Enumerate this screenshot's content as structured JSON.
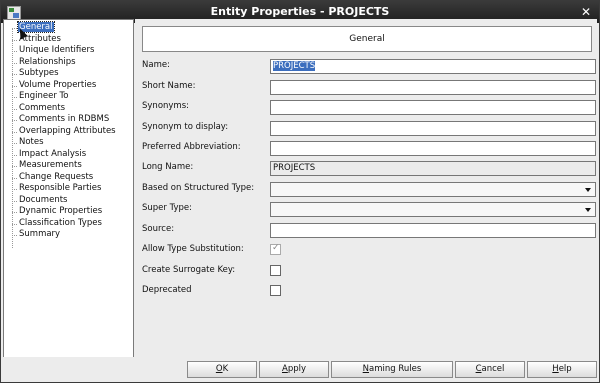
{
  "window": {
    "title": "Entity Properties - PROJECTS",
    "close_glyph": "✕"
  },
  "nav": {
    "items": [
      {
        "label": "General",
        "selected": true
      },
      {
        "label": "Attributes"
      },
      {
        "label": "Unique Identifiers"
      },
      {
        "label": "Relationships"
      },
      {
        "label": "Subtypes"
      },
      {
        "label": "Volume Properties"
      },
      {
        "label": "Engineer To"
      },
      {
        "label": "Comments"
      },
      {
        "label": "Comments in RDBMS"
      },
      {
        "label": "Overlapping Attributes"
      },
      {
        "label": "Notes"
      },
      {
        "label": "Impact Analysis"
      },
      {
        "label": "Measurements"
      },
      {
        "label": "Change Requests"
      },
      {
        "label": "Responsible Parties"
      },
      {
        "label": "Documents"
      },
      {
        "label": "Dynamic Properties"
      },
      {
        "label": "Classification Types"
      },
      {
        "label": "Summary"
      }
    ]
  },
  "panel": {
    "header": "General",
    "name": {
      "label": "Name:",
      "value": "PROJECTS"
    },
    "short_name": {
      "label": "Short Name:",
      "value": ""
    },
    "synonyms": {
      "label": "Synonyms:",
      "value": ""
    },
    "synonym_display": {
      "label": "Synonym to display:",
      "value": ""
    },
    "preferred_abbrev": {
      "label": "Preferred Abbreviation:",
      "value": ""
    },
    "long_name": {
      "label": "Long Name:",
      "value": "PROJECTS"
    },
    "based_on": {
      "label": "Based on Structured Type:",
      "value": ""
    },
    "super_type": {
      "label": "Super Type:",
      "value": ""
    },
    "source": {
      "label": "Source:",
      "value": ""
    },
    "allow_subst": {
      "label": "Allow Type Substitution:",
      "checked": true
    },
    "surrogate": {
      "label": "Create Surrogate Key:",
      "checked": false
    },
    "deprecated": {
      "label": "Deprecated",
      "checked": false
    }
  },
  "buttons": {
    "ok": {
      "mnemonic": "O",
      "rest": "K"
    },
    "apply": {
      "mnemonic": "A",
      "rest": "pply"
    },
    "naming": {
      "mnemonic": "N",
      "rest": "aming Rules"
    },
    "cancel": {
      "mnemonic": "C",
      "rest": "ancel"
    },
    "help": {
      "mnemonic": "H",
      "rest": "elp"
    }
  }
}
